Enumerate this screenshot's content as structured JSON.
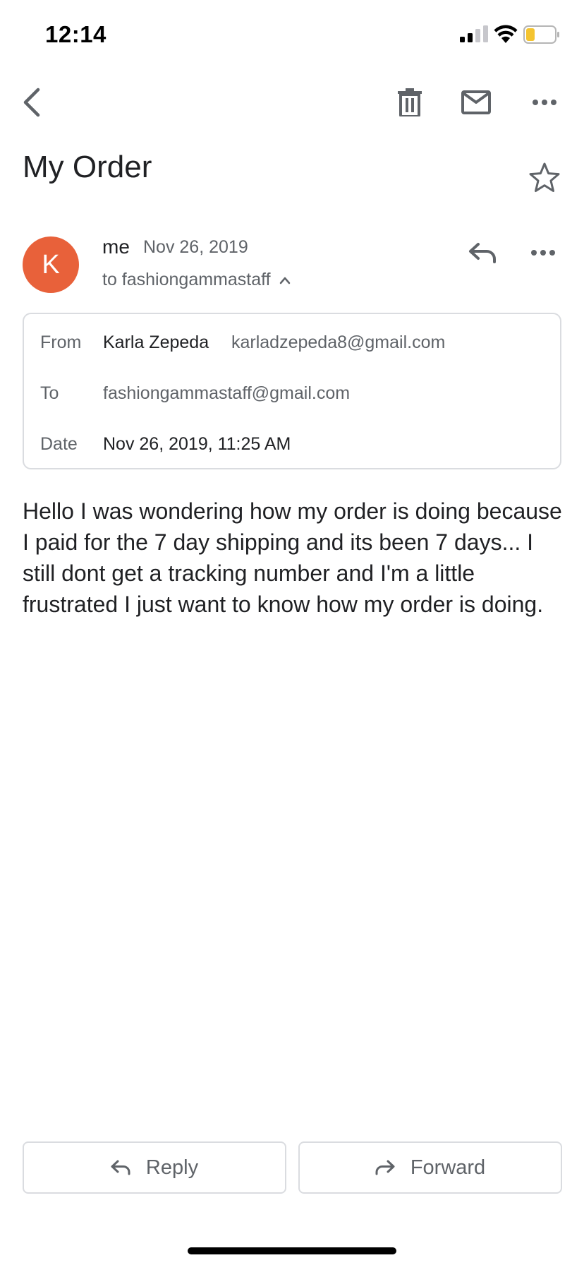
{
  "status_bar": {
    "time": "12:14",
    "signal_icon": "cellular-signal-icon",
    "wifi_icon": "wifi-icon",
    "battery_icon": "battery-low-icon",
    "battery_color": "#f4c430"
  },
  "toolbar": {
    "back_icon": "chevron-left-icon",
    "delete_icon": "trash-icon",
    "mark_unread_icon": "mail-icon",
    "more_icon": "more-horizontal-icon"
  },
  "email": {
    "subject": "My Order",
    "star_icon": "star-outline-icon",
    "avatar_letter": "K",
    "avatar_color": "#e8613a",
    "sender": "me",
    "date": "Nov 26, 2019",
    "recipient_summary": "to fashiongammastaff",
    "details": {
      "from_label": "From",
      "from_name": "Karla Zepeda",
      "from_email": "karladzepeda8@gmail.com",
      "to_label": "To",
      "to_email": "fashiongammastaff@gmail.com",
      "date_label": "Date",
      "date_value": "Nov 26, 2019, 11:25 AM"
    },
    "body": "Hello I was wondering how my order is doing because I paid for the 7 day shipping and its been 7 days... I still dont get a tracking number and I'm a little frustrated I just want to know how my order is doing."
  },
  "actions": {
    "reply_label": "Reply",
    "forward_label": "Forward"
  }
}
